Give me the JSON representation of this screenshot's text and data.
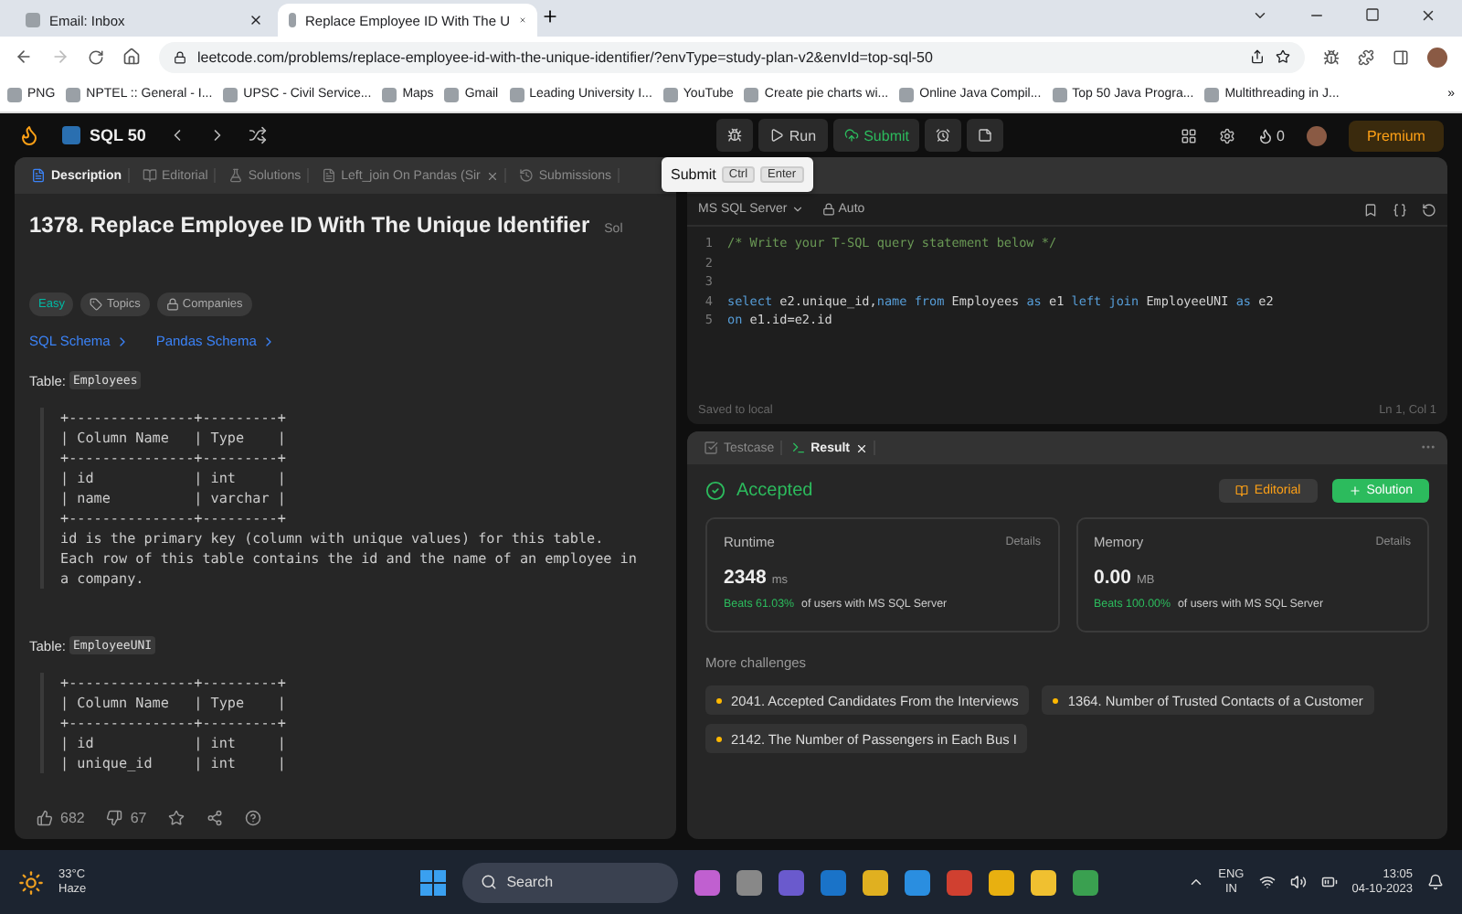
{
  "browser": {
    "tabs": [
      {
        "title": "Email: Inbox",
        "selected": false
      },
      {
        "title": "Replace Employee ID With The U",
        "selected": true
      }
    ],
    "url": "leetcode.com/problems/replace-employee-id-with-the-unique-identifier/?envType=study-plan-v2&envId=top-sql-50",
    "bookmarks": [
      "PNG",
      "NPTEL :: General - I...",
      "UPSC - Civil Service...",
      "Maps",
      "Gmail",
      "Leading University I...",
      "YouTube",
      "Create pie charts wi...",
      "Online Java Compil...",
      "Top 50 Java Progra...",
      "Multithreading in J..."
    ],
    "bookmarks_more": "»"
  },
  "toolbar": {
    "list_name": "SQL 50",
    "run": "Run",
    "submit": "Submit",
    "streak": "0",
    "premium": "Premium"
  },
  "tooltip": {
    "label": "Submit",
    "keys": [
      "Ctrl",
      "Enter"
    ]
  },
  "description": {
    "tabs": [
      {
        "label": "Description",
        "kind": "description",
        "selected": true,
        "closable": false
      },
      {
        "label": "Editorial",
        "kind": "editorial",
        "selected": false,
        "closable": false
      },
      {
        "label": "Solutions",
        "kind": "solutions",
        "selected": false,
        "closable": false
      },
      {
        "label": "Left_join On Pandas (Sir",
        "kind": "note",
        "selected": false,
        "closable": true
      },
      {
        "label": "Submissions",
        "kind": "submissions",
        "selected": false,
        "closable": false
      }
    ],
    "title": "1378. Replace Employee ID With The Unique Identifier",
    "title_aside": "Sol",
    "tags": [
      {
        "label": "Easy",
        "kind": "difficulty"
      },
      {
        "label": "Topics",
        "kind": "topics"
      },
      {
        "label": "Companies",
        "kind": "companies"
      }
    ],
    "links": [
      "SQL Schema",
      "Pandas Schema"
    ],
    "schemas": [
      {
        "label": "Table:",
        "name": "Employees",
        "lines": [
          "+---------------+---------+",
          "| Column Name   | Type    |",
          "+---------------+---------+",
          "| id            | int     |",
          "| name          | varchar |",
          "+---------------+---------+",
          "id is the primary key (column with unique values) for this table.",
          "Each row of this table contains the id and the name of an employee in",
          "a company."
        ]
      },
      {
        "label": "Table:",
        "name": "EmployeeUNI",
        "lines": [
          "+---------------+---------+",
          "| Column Name   | Type    |",
          "+---------------+---------+",
          "| id            | int     |",
          "| unique_id     | int     |"
        ]
      }
    ],
    "likes": "682",
    "dislikes": "67"
  },
  "editor": {
    "language": "MS SQL Server",
    "mode": "Auto",
    "lines": [
      {
        "number": "1",
        "tokens": [
          {
            "kind": "comment",
            "text": "/* Write your T-SQL query statement below */"
          }
        ]
      },
      {
        "number": "2"
      },
      {
        "number": "3"
      },
      {
        "number": "4",
        "tokens": [
          {
            "kind": "keyword",
            "text": "select"
          },
          {
            "kind": "plain",
            "text": " e2.unique_id,"
          },
          {
            "kind": "keyword",
            "text": "name"
          },
          {
            "kind": "keyword",
            "text": " from"
          },
          {
            "kind": "plain",
            "text": " Employees "
          },
          {
            "kind": "keyword",
            "text": "as"
          },
          {
            "kind": "plain",
            "text": " e1 "
          },
          {
            "kind": "keyword",
            "text": "left join"
          },
          {
            "kind": "plain",
            "text": " EmployeeUNI "
          },
          {
            "kind": "keyword",
            "text": "as"
          },
          {
            "kind": "plain",
            "text": " e2"
          }
        ]
      },
      {
        "number": "5",
        "tokens": [
          {
            "kind": "keyword",
            "text": "on"
          },
          {
            "kind": "plain",
            "text": " e1.id=e2.id"
          }
        ]
      }
    ],
    "saved": "Saved to local",
    "cursor": "Ln 1, Col 1"
  },
  "result": {
    "tabs": [
      {
        "label": "Testcase",
        "selected": false,
        "closable": false
      },
      {
        "label": "Result",
        "selected": true,
        "closable": true
      }
    ],
    "status": "Accepted",
    "editorial": "Editorial",
    "solution": "Solution",
    "cards": [
      {
        "title": "Runtime",
        "details": "Details",
        "value": "2348",
        "unit": "ms",
        "beats": "Beats 61.03%",
        "beats_rest": "of users with MS SQL Server"
      },
      {
        "title": "Memory",
        "details": "Details",
        "value": "0.00",
        "unit": "MB",
        "beats": "Beats 100.00%",
        "beats_rest": "of users with MS SQL Server"
      }
    ],
    "more_title": "More challenges",
    "challenges": [
      "2041. Accepted Candidates From the Interviews",
      "1364. Number of Trusted Contacts of a Customer",
      "2142. The Number of Passengers in Each Bus I"
    ]
  },
  "taskbar": {
    "temperature": "33°C",
    "weather": "Haze",
    "search": "Search",
    "language": [
      "ENG",
      "IN"
    ],
    "time": "13:05",
    "date": "04-10-2023"
  }
}
